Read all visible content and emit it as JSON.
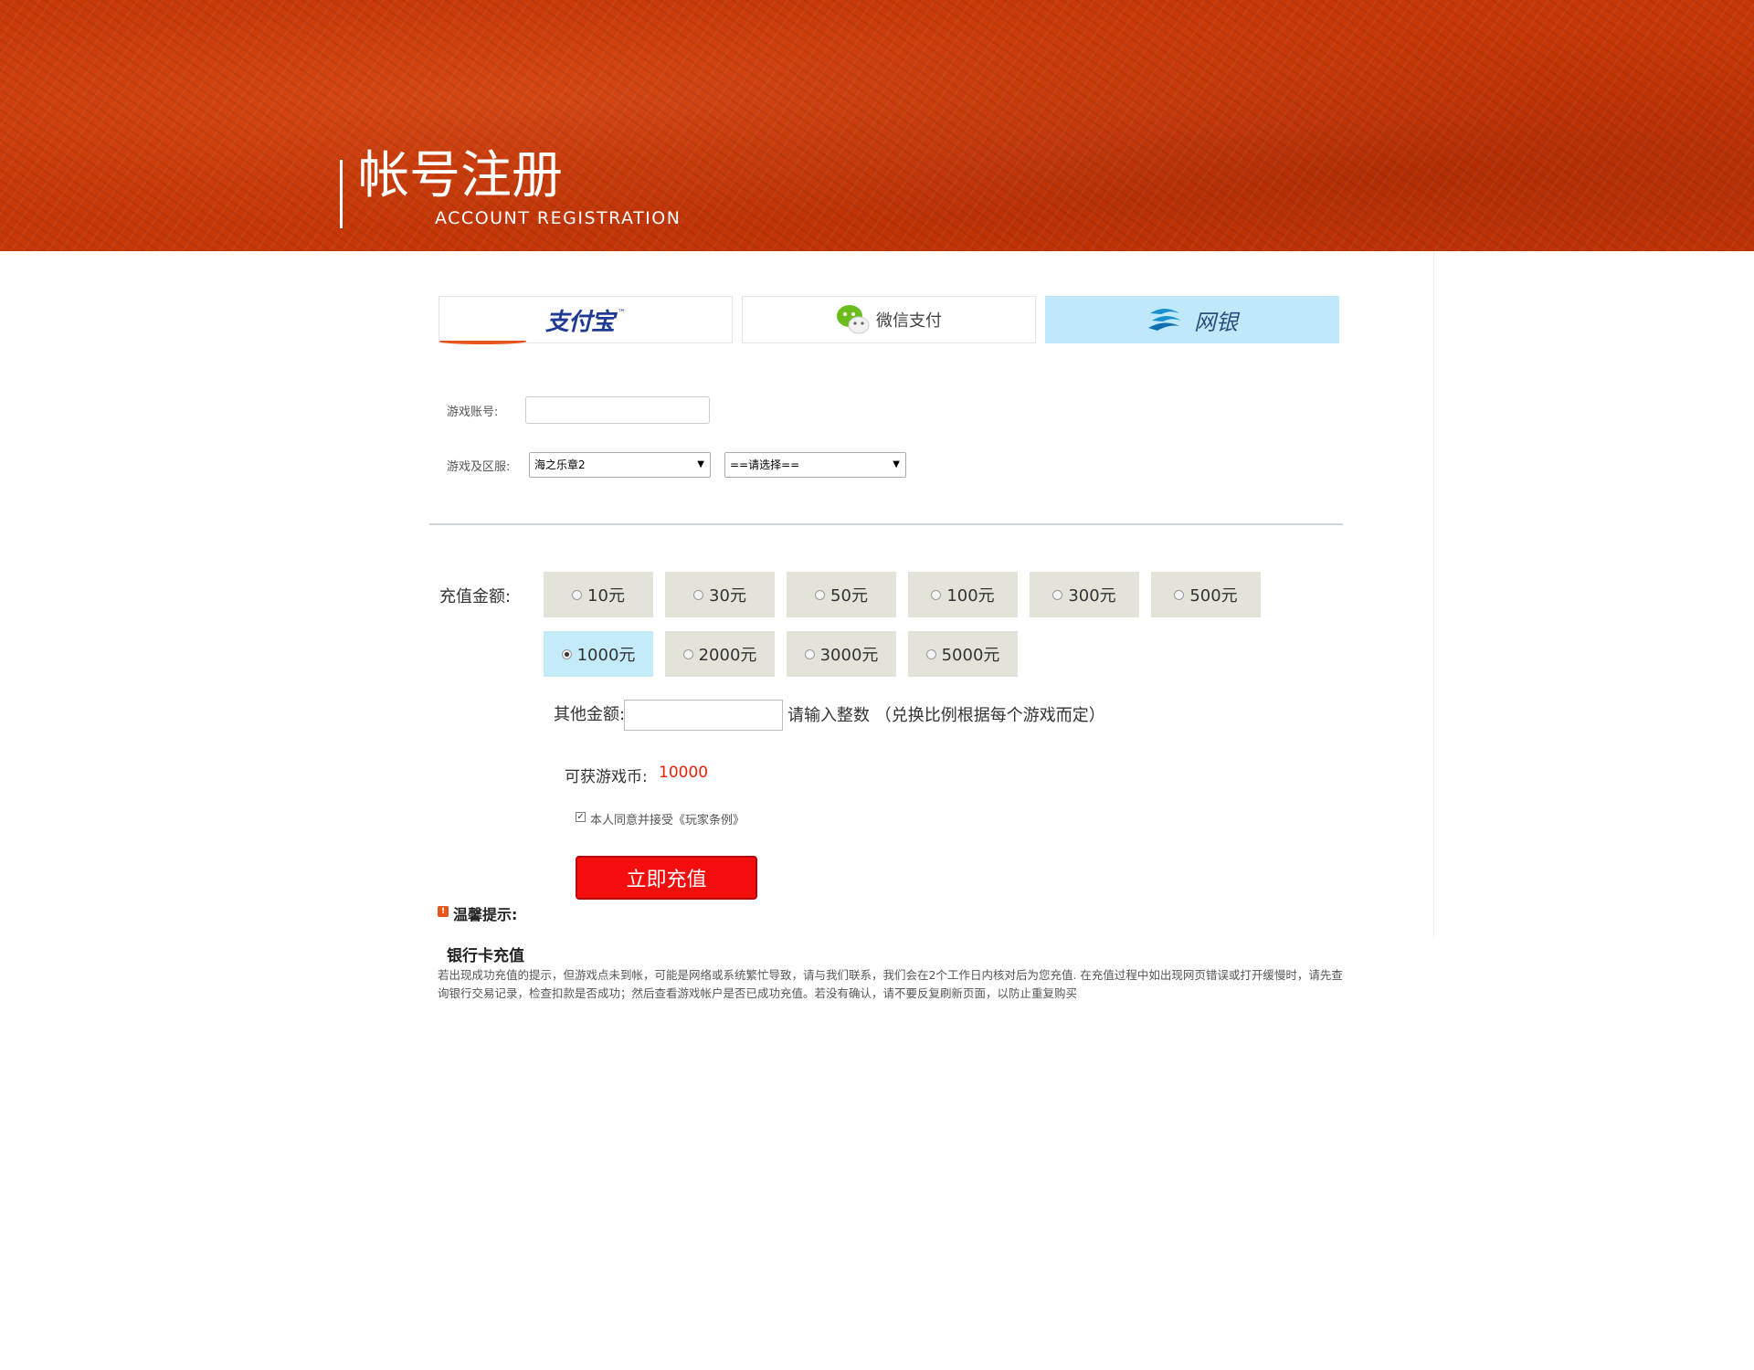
{
  "header": {
    "title": "帐号注册",
    "subtitle": "ACCOUNT REGISTRATION"
  },
  "payment_tabs": [
    {
      "label": "支付宝",
      "icon": "alipay-logo",
      "active": false
    },
    {
      "label": "微信支付",
      "icon": "wechat-icon",
      "active": false
    },
    {
      "label": "网银",
      "icon": "bank-logo-icon",
      "active": true
    }
  ],
  "form": {
    "account_label": "游戏账号:",
    "account_value": "",
    "server_label": "游戏及区服:",
    "game_select": "海之乐章2",
    "server_select": "==请选择=="
  },
  "recharge": {
    "amount_label": "充值金额:",
    "options": [
      "10元",
      "30元",
      "50元",
      "100元",
      "300元",
      "500元",
      "1000元",
      "2000元",
      "3000元",
      "5000元"
    ],
    "selected": "1000元",
    "other_label": "其他金额:",
    "other_value": "",
    "other_hint": "请输入整数 （兑换比例根据每个游戏而定）",
    "coins_label": "可获游戏币:",
    "coins_value": "10000",
    "agree_text": "本人同意并接受《玩家条例》",
    "agree_checked": true,
    "submit_label": "立即充值"
  },
  "tips": {
    "title": "温馨提示:",
    "bank_title": "银行卡充值",
    "body": "若出现成功充值的提示，但游戏点未到帐，可能是网络或系统繁忙导致，请与我们联系，我们会在2个工作日内核对后为您充值. 在充值过程中如出现网页错误或打开缓慢时，请先查询银行交易记录，检查扣款是否成功；然后查看游戏帐户是否已成功充值。若没有确认，请不要反复刷新页面，以防止重复购买"
  },
  "colors": {
    "banner": "#c63707",
    "active_tab": "#bfe9fb",
    "amount_bg": "#e3e3da",
    "amount_selected": "#c3ebfa",
    "submit": "#f40d0d",
    "coins": "#e8200c"
  }
}
